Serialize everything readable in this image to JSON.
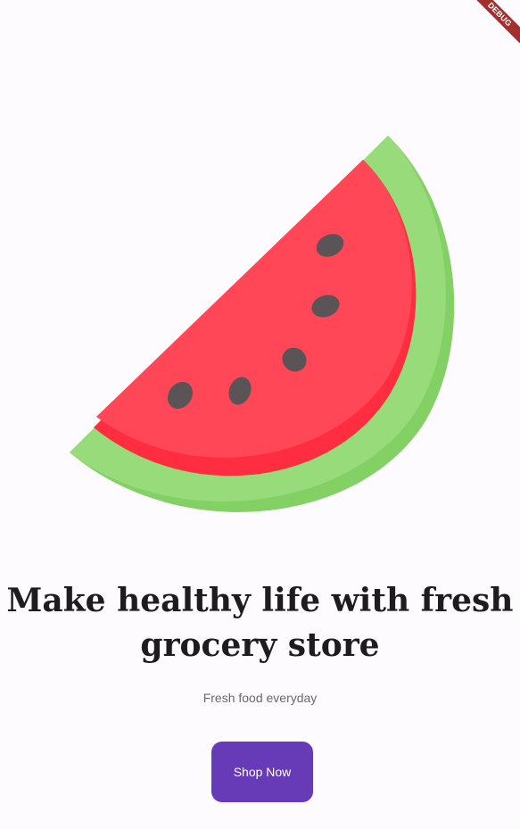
{
  "debug_banner": {
    "label": "DEBUG"
  },
  "hero": {
    "image": "watermelon-slice-illustration"
  },
  "headline": "Make healthy life with fresh grocery store",
  "subtitle": "Fresh food everyday",
  "cta": {
    "label": "Shop Now"
  },
  "colors": {
    "background": "#fefbfe",
    "rind_light": "#98db7b",
    "rind_dark": "#83d064",
    "flesh": "#ff4757",
    "flesh_shadow": "#ff2d3f",
    "seed": "#5b5457",
    "button": "#673ab7",
    "headline_text": "#1f1b1f",
    "subtitle_text": "#6b6670"
  }
}
